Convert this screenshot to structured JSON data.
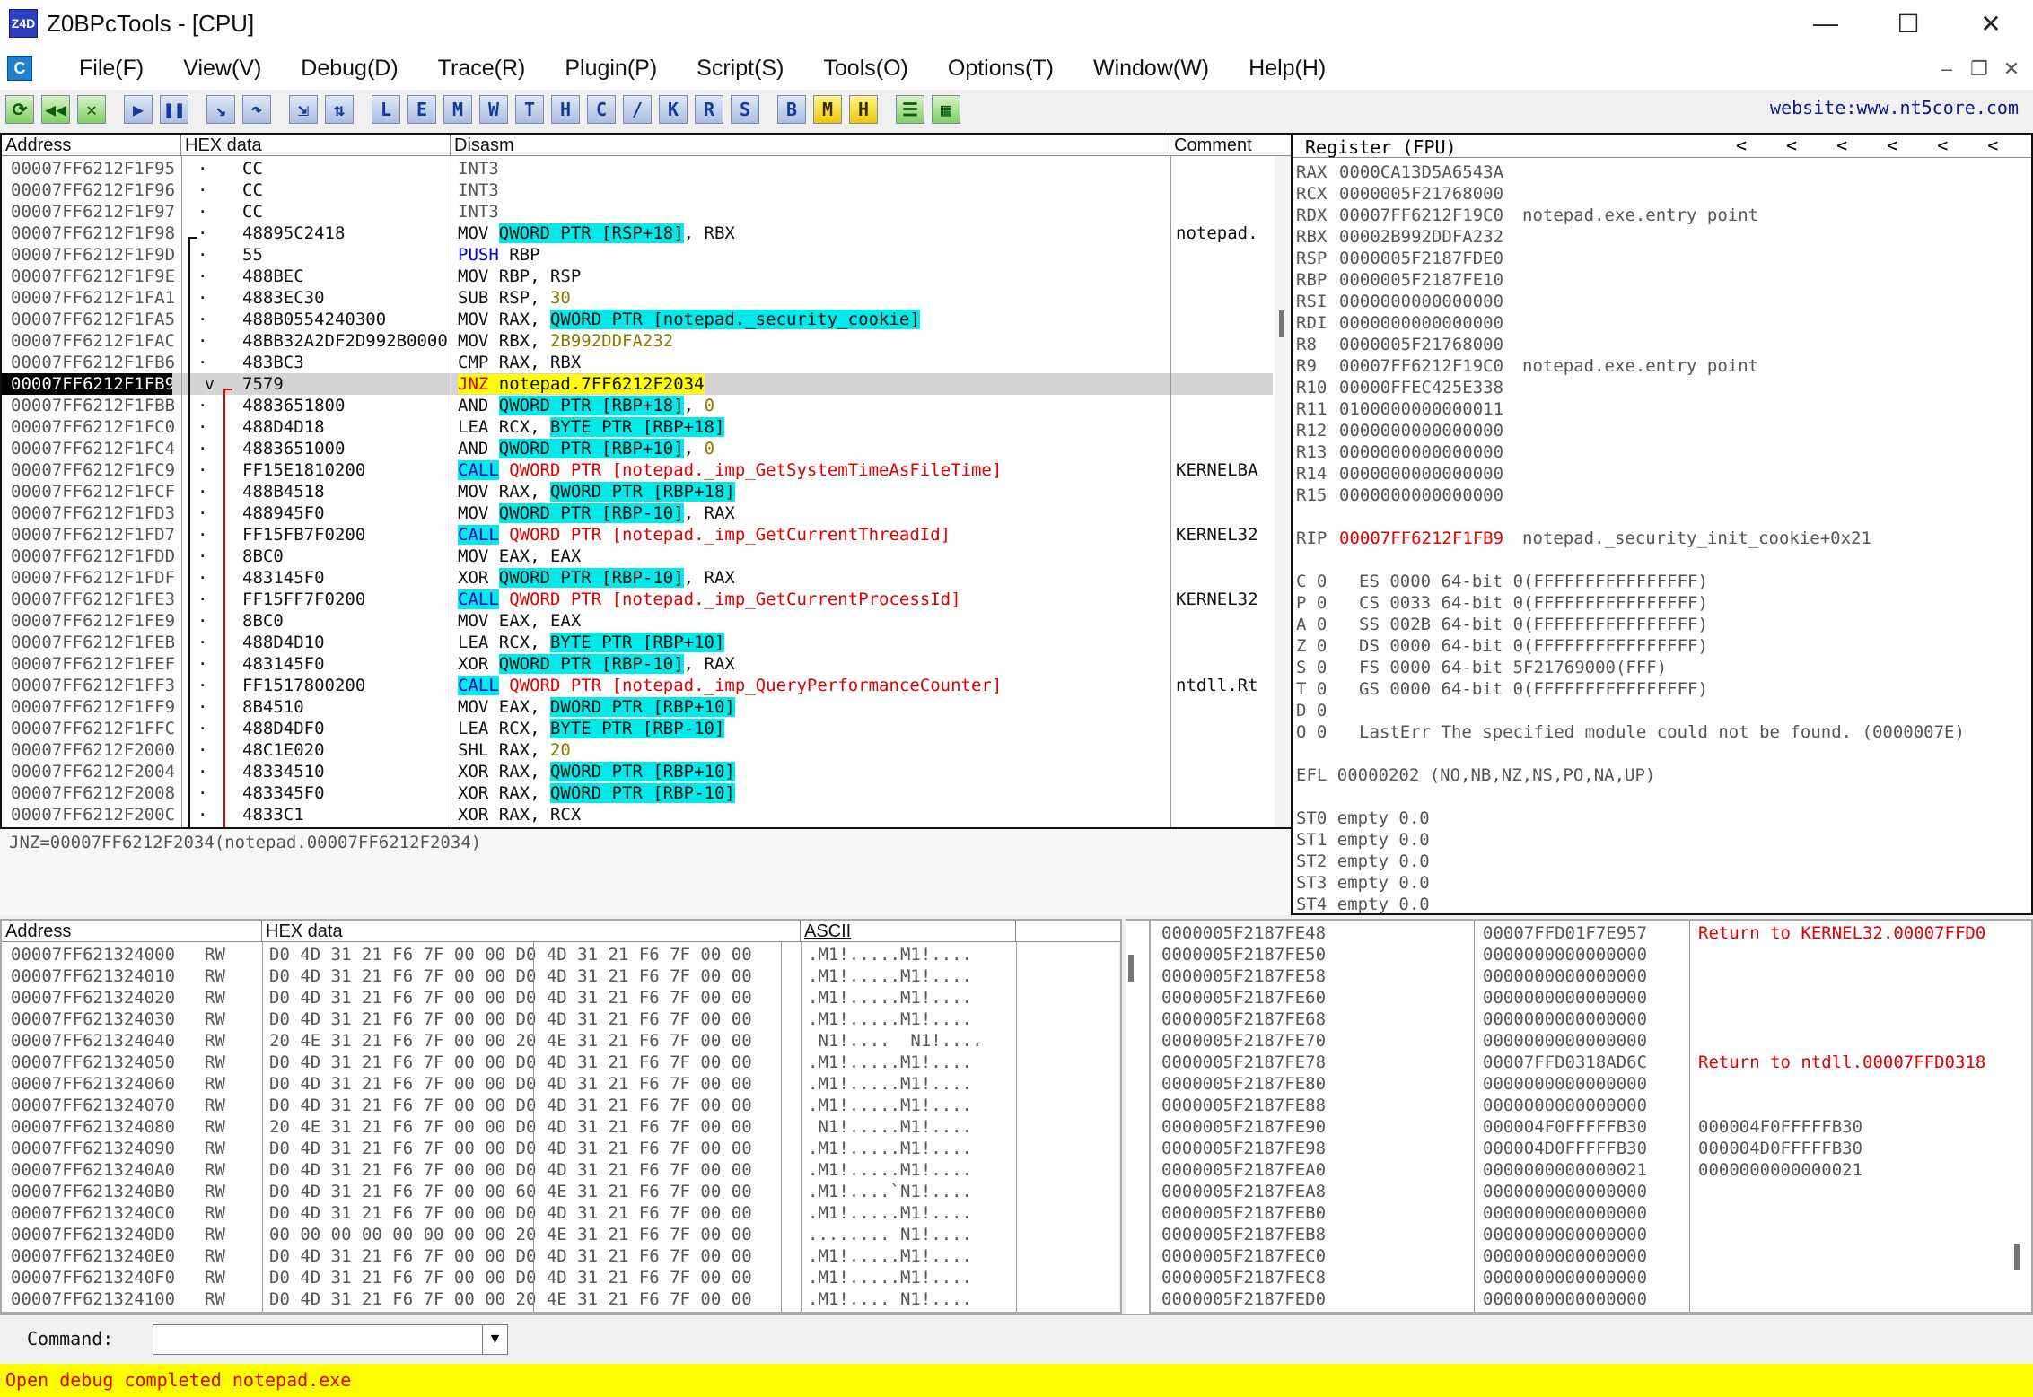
{
  "window": {
    "app_icon_text": "Z4D",
    "title": "Z0BPcTools - [CPU]",
    "minimize": "—",
    "maximize": "☐",
    "close": "✕"
  },
  "menu": {
    "app_icon_text": "C",
    "items": [
      "File(F)",
      "View(V)",
      "Debug(D)",
      "Trace(R)",
      "Plugin(P)",
      "Script(S)",
      "Tools(O)",
      "Options(T)",
      "Window(W)",
      "Help(H)"
    ],
    "mdi_min": "–",
    "mdi_restore": "❐",
    "mdi_close": "✕"
  },
  "toolbar": {
    "buttons": [
      {
        "name": "restart",
        "glyph": "⟳",
        "style": "g"
      },
      {
        "name": "rewind",
        "glyph": "◀◀",
        "style": "g"
      },
      {
        "name": "close-debug",
        "glyph": "✕",
        "style": "g"
      },
      {
        "name": "run",
        "glyph": "▶",
        "style": "",
        "gap": true
      },
      {
        "name": "pause",
        "glyph": "❚❚",
        "style": ""
      },
      {
        "name": "step-into",
        "glyph": "↘",
        "style": "",
        "gap": true
      },
      {
        "name": "step-over",
        "glyph": "↷",
        "style": ""
      },
      {
        "name": "trace-into",
        "glyph": "⇲",
        "style": "",
        "gap": true
      },
      {
        "name": "trace-over",
        "glyph": "⇅",
        "style": ""
      },
      {
        "name": "L",
        "glyph": "L",
        "style": "",
        "gap": true
      },
      {
        "name": "E",
        "glyph": "E",
        "style": ""
      },
      {
        "name": "M",
        "glyph": "M",
        "style": ""
      },
      {
        "name": "W",
        "glyph": "W",
        "style": ""
      },
      {
        "name": "T",
        "glyph": "T",
        "style": ""
      },
      {
        "name": "H",
        "glyph": "H",
        "style": ""
      },
      {
        "name": "C",
        "glyph": "C",
        "style": ""
      },
      {
        "name": "slash",
        "glyph": "/",
        "style": ""
      },
      {
        "name": "K",
        "glyph": "K",
        "style": ""
      },
      {
        "name": "R",
        "glyph": "R",
        "style": ""
      },
      {
        "name": "S",
        "glyph": "S",
        "style": ""
      },
      {
        "name": "B",
        "glyph": "B",
        "style": "",
        "gap": true
      },
      {
        "name": "M-yellow",
        "glyph": "M",
        "style": "y"
      },
      {
        "name": "H-yellow",
        "glyph": "H",
        "style": "y"
      },
      {
        "name": "list",
        "glyph": "☰",
        "style": "g",
        "gap": true
      },
      {
        "name": "grid",
        "glyph": "▦",
        "style": "g"
      }
    ],
    "website": "website:www.nt5core.com"
  },
  "disasm": {
    "headers": {
      "address": "Address",
      "hex": "HEX data",
      "disasm": "Disasm",
      "comment": "Comment"
    },
    "rows": [
      {
        "addr": "00007FF6212F1F95",
        "hex": "CC",
        "ins": [
          {
            "t": "INT3",
            "c": "gray"
          }
        ],
        "comment": ""
      },
      {
        "addr": "00007FF6212F1F96",
        "hex": "CC",
        "ins": [
          {
            "t": "INT3",
            "c": "gray"
          }
        ],
        "comment": ""
      },
      {
        "addr": "00007FF6212F1F97",
        "hex": "CC",
        "ins": [
          {
            "t": "INT3",
            "c": "gray"
          }
        ],
        "comment": ""
      },
      {
        "addr": "00007FF6212F1F98",
        "hex": "48895C2418",
        "ins": [
          {
            "t": "MOV "
          },
          {
            "t": "QWORD PTR [RSP+18]",
            "c": "cyan"
          },
          {
            "t": ", RBX"
          }
        ],
        "comment": "notepad."
      },
      {
        "addr": "00007FF6212F1F9D",
        "hex": "55",
        "ins": [
          {
            "t": "PUSH ",
            "c": "navy"
          },
          {
            "t": "RBP"
          }
        ],
        "comment": ""
      },
      {
        "addr": "00007FF6212F1F9E",
        "hex": "488BEC",
        "ins": [
          {
            "t": "MOV RBP, RSP"
          }
        ],
        "comment": ""
      },
      {
        "addr": "00007FF6212F1FA1",
        "hex": "4883EC30",
        "ins": [
          {
            "t": "SUB RSP, "
          },
          {
            "t": "30",
            "c": "olive"
          }
        ],
        "comment": ""
      },
      {
        "addr": "00007FF6212F1FA5",
        "hex": "488B0554240300",
        "ins": [
          {
            "t": "MOV RAX, "
          },
          {
            "t": "QWORD PTR [notepad._security_cookie]",
            "c": "cyan"
          }
        ],
        "comment": ""
      },
      {
        "addr": "00007FF6212F1FAC",
        "hex": "48BB32A2DF2D992B0000",
        "ins": [
          {
            "t": "MOV RBX, "
          },
          {
            "t": "2B992DDFA232",
            "c": "olive"
          }
        ],
        "comment": ""
      },
      {
        "addr": "00007FF6212F1FB6",
        "hex": "483BC3",
        "ins": [
          {
            "t": "CMP RAX, RBX"
          }
        ],
        "comment": ""
      },
      {
        "addr": "00007FF6212F1FB9",
        "hex": "7579",
        "ins": [
          {
            "t": "JNZ",
            "c": "yelred"
          },
          {
            "t": " notepad.7FF6212F2034",
            "c": "yel"
          }
        ],
        "comment": "",
        "sel": true
      },
      {
        "addr": "00007FF6212F1FBB",
        "hex": "4883651800",
        "ins": [
          {
            "t": "AND "
          },
          {
            "t": "QWORD PTR [RBP+18]",
            "c": "cyan"
          },
          {
            "t": ", "
          },
          {
            "t": "0",
            "c": "olive"
          }
        ],
        "comment": ""
      },
      {
        "addr": "00007FF6212F1FC0",
        "hex": "488D4D18",
        "ins": [
          {
            "t": "LEA RCX, "
          },
          {
            "t": "BYTE PTR [RBP+18]",
            "c": "cyan"
          }
        ],
        "comment": ""
      },
      {
        "addr": "00007FF6212F1FC4",
        "hex": "4883651000",
        "ins": [
          {
            "t": "AND "
          },
          {
            "t": "QWORD PTR [RBP+10]",
            "c": "cyan"
          },
          {
            "t": ", "
          },
          {
            "t": "0",
            "c": "olive"
          }
        ],
        "comment": ""
      },
      {
        "addr": "00007FF6212F1FC9",
        "hex": "FF15E1810200",
        "ins": [
          {
            "t": "CALL",
            "c": "cyanblue"
          },
          {
            "t": " QWORD PTR [notepad._imp_GetSystemTimeAsFileTime]",
            "c": "red"
          }
        ],
        "comment": "KERNELBA"
      },
      {
        "addr": "00007FF6212F1FCF",
        "hex": "488B4518",
        "ins": [
          {
            "t": "MOV RAX, "
          },
          {
            "t": "QWORD PTR [RBP+18]",
            "c": "cyan"
          }
        ],
        "comment": ""
      },
      {
        "addr": "00007FF6212F1FD3",
        "hex": "488945F0",
        "ins": [
          {
            "t": "MOV "
          },
          {
            "t": "QWORD PTR [RBP-10]",
            "c": "cyan"
          },
          {
            "t": ", RAX"
          }
        ],
        "comment": ""
      },
      {
        "addr": "00007FF6212F1FD7",
        "hex": "FF15FB7F0200",
        "ins": [
          {
            "t": "CALL",
            "c": "cyanblue"
          },
          {
            "t": " QWORD PTR [notepad._imp_GetCurrentThreadId]",
            "c": "red"
          }
        ],
        "comment": "KERNEL32"
      },
      {
        "addr": "00007FF6212F1FDD",
        "hex": "8BC0",
        "ins": [
          {
            "t": "MOV EAX, EAX"
          }
        ],
        "comment": ""
      },
      {
        "addr": "00007FF6212F1FDF",
        "hex": "483145F0",
        "ins": [
          {
            "t": "XOR "
          },
          {
            "t": "QWORD PTR [RBP-10]",
            "c": "cyan"
          },
          {
            "t": ", RAX"
          }
        ],
        "comment": ""
      },
      {
        "addr": "00007FF6212F1FE3",
        "hex": "FF15FF7F0200",
        "ins": [
          {
            "t": "CALL",
            "c": "cyanblue"
          },
          {
            "t": " QWORD PTR [notepad._imp_GetCurrentProcessId]",
            "c": "red"
          }
        ],
        "comment": "KERNEL32"
      },
      {
        "addr": "00007FF6212F1FE9",
        "hex": "8BC0",
        "ins": [
          {
            "t": "MOV EAX, EAX"
          }
        ],
        "comment": ""
      },
      {
        "addr": "00007FF6212F1FEB",
        "hex": "488D4D10",
        "ins": [
          {
            "t": "LEA RCX, "
          },
          {
            "t": "BYTE PTR [RBP+10]",
            "c": "cyan"
          }
        ],
        "comment": ""
      },
      {
        "addr": "00007FF6212F1FEF",
        "hex": "483145F0",
        "ins": [
          {
            "t": "XOR "
          },
          {
            "t": "QWORD PTR [RBP-10]",
            "c": "cyan"
          },
          {
            "t": ", RAX"
          }
        ],
        "comment": ""
      },
      {
        "addr": "00007FF6212F1FF3",
        "hex": "FF1517800200",
        "ins": [
          {
            "t": "CALL",
            "c": "cyanblue"
          },
          {
            "t": " QWORD PTR [notepad._imp_QueryPerformanceCounter]",
            "c": "red"
          }
        ],
        "comment": "ntdll.Rt"
      },
      {
        "addr": "00007FF6212F1FF9",
        "hex": "8B4510",
        "ins": [
          {
            "t": "MOV EAX, "
          },
          {
            "t": "DWORD PTR [RBP+10]",
            "c": "cyan"
          }
        ],
        "comment": ""
      },
      {
        "addr": "00007FF6212F1FFC",
        "hex": "488D4DF0",
        "ins": [
          {
            "t": "LEA RCX, "
          },
          {
            "t": "BYTE PTR [RBP-10]",
            "c": "cyan"
          }
        ],
        "comment": ""
      },
      {
        "addr": "00007FF6212F2000",
        "hex": "48C1E020",
        "ins": [
          {
            "t": "SHL RAX, "
          },
          {
            "t": "20",
            "c": "olive"
          }
        ],
        "comment": ""
      },
      {
        "addr": "00007FF6212F2004",
        "hex": "48334510",
        "ins": [
          {
            "t": "XOR RAX, "
          },
          {
            "t": "QWORD PTR [RBP+10]",
            "c": "cyan"
          }
        ],
        "comment": ""
      },
      {
        "addr": "00007FF6212F2008",
        "hex": "483345F0",
        "ins": [
          {
            "t": "XOR RAX, "
          },
          {
            "t": "QWORD PTR [RBP-10]",
            "c": "cyan"
          }
        ],
        "comment": ""
      },
      {
        "addr": "00007FF6212F200C",
        "hex": "4833C1",
        "ins": [
          {
            "t": "XOR RAX, RCX"
          }
        ],
        "comment": ""
      }
    ],
    "jump_marker": "v",
    "info_line": "JNZ=00007FF6212F2034(notepad.00007FF6212F2034)"
  },
  "registers": {
    "header": "Register (FPU)",
    "nav": [
      "<",
      "<",
      "<",
      "<",
      "<",
      "<"
    ],
    "gp": [
      {
        "n": "RAX",
        "v": "0000CA13D5A6543A",
        "c": ""
      },
      {
        "n": "RCX",
        "v": "0000005F21768000",
        "c": ""
      },
      {
        "n": "RDX",
        "v": "00007FF6212F19C0",
        "c": "notepad.exe.entry point"
      },
      {
        "n": "RBX",
        "v": "00002B992DDFA232",
        "c": ""
      },
      {
        "n": "RSP",
        "v": "0000005F2187FDE0",
        "c": ""
      },
      {
        "n": "RBP",
        "v": "0000005F2187FE10",
        "c": ""
      },
      {
        "n": "RSI",
        "v": "0000000000000000",
        "c": ""
      },
      {
        "n": "RDI",
        "v": "0000000000000000",
        "c": ""
      },
      {
        "n": "R8",
        "v": "0000005F21768000",
        "c": ""
      },
      {
        "n": "R9",
        "v": "00007FF6212F19C0",
        "c": "notepad.exe.entry point"
      },
      {
        "n": "R10",
        "v": "00000FFEC425E338",
        "c": ""
      },
      {
        "n": "R11",
        "v": "0100000000000011",
        "c": ""
      },
      {
        "n": "R12",
        "v": "0000000000000000",
        "c": ""
      },
      {
        "n": "R13",
        "v": "0000000000000000",
        "c": ""
      },
      {
        "n": "R14",
        "v": "0000000000000000",
        "c": ""
      },
      {
        "n": "R15",
        "v": "0000000000000000",
        "c": ""
      }
    ],
    "rip": {
      "n": "RIP",
      "v": "00007FF6212F1FB9",
      "c": "notepad._security_init_cookie+0x21"
    },
    "flags": [
      {
        "f": "C 0",
        "s": "ES 0000 64-bit 0(FFFFFFFFFFFFFFFF)"
      },
      {
        "f": "P 0",
        "s": "CS 0033 64-bit 0(FFFFFFFFFFFFFFFF)"
      },
      {
        "f": "A 0",
        "s": "SS 002B 64-bit 0(FFFFFFFFFFFFFFFF)"
      },
      {
        "f": "Z 0",
        "s": "DS 0000 64-bit 0(FFFFFFFFFFFFFFFF)"
      },
      {
        "f": "S 0",
        "s": "FS 0000 64-bit 5F21769000(FFF)"
      },
      {
        "f": "T 0",
        "s": "GS 0000 64-bit 0(FFFFFFFFFFFFFFFF)"
      },
      {
        "f": "D 0",
        "s": ""
      },
      {
        "f": "O 0",
        "s": "LastErr The specified module could not be found. (0000007E)"
      }
    ],
    "efl": "EFL 00000202 (NO,NB,NZ,NS,PO,NA,UP)",
    "fpu": [
      "ST0 empty 0.0",
      "ST1 empty 0.0",
      "ST2 empty 0.0",
      "ST3 empty 0.0",
      "ST4 empty 0.0"
    ]
  },
  "dump": {
    "headers": {
      "address": "Address",
      "hex": "HEX data",
      "ascii": "ASCII"
    },
    "rows": [
      {
        "a": "00007FF621324000",
        "p": "RW",
        "h": "D0 4D 31 21 F6 7F 00 00 D0 4D 31 21 F6 7F 00 00",
        "s": ".M1!.....M1!...."
      },
      {
        "a": "00007FF621324010",
        "p": "RW",
        "h": "D0 4D 31 21 F6 7F 00 00 D0 4D 31 21 F6 7F 00 00",
        "s": ".M1!.....M1!...."
      },
      {
        "a": "00007FF621324020",
        "p": "RW",
        "h": "D0 4D 31 21 F6 7F 00 00 D0 4D 31 21 F6 7F 00 00",
        "s": ".M1!.....M1!...."
      },
      {
        "a": "00007FF621324030",
        "p": "RW",
        "h": "D0 4D 31 21 F6 7F 00 00 D0 4D 31 21 F6 7F 00 00",
        "s": ".M1!.....M1!...."
      },
      {
        "a": "00007FF621324040",
        "p": "RW",
        "h": "20 4E 31 21 F6 7F 00 00 20 4E 31 21 F6 7F 00 00",
        "s": " N1!....  N1!...."
      },
      {
        "a": "00007FF621324050",
        "p": "RW",
        "h": "D0 4D 31 21 F6 7F 00 00 D0 4D 31 21 F6 7F 00 00",
        "s": ".M1!.....M1!...."
      },
      {
        "a": "00007FF621324060",
        "p": "RW",
        "h": "D0 4D 31 21 F6 7F 00 00 D0 4D 31 21 F6 7F 00 00",
        "s": ".M1!.....M1!...."
      },
      {
        "a": "00007FF621324070",
        "p": "RW",
        "h": "D0 4D 31 21 F6 7F 00 00 D0 4D 31 21 F6 7F 00 00",
        "s": ".M1!.....M1!...."
      },
      {
        "a": "00007FF621324080",
        "p": "RW",
        "h": "20 4E 31 21 F6 7F 00 00 D0 4D 31 21 F6 7F 00 00",
        "s": " N1!.....M1!...."
      },
      {
        "a": "00007FF621324090",
        "p": "RW",
        "h": "D0 4D 31 21 F6 7F 00 00 D0 4D 31 21 F6 7F 00 00",
        "s": ".M1!.....M1!...."
      },
      {
        "a": "00007FF6213240A0",
        "p": "RW",
        "h": "D0 4D 31 21 F6 7F 00 00 D0 4D 31 21 F6 7F 00 00",
        "s": ".M1!.....M1!...."
      },
      {
        "a": "00007FF6213240B0",
        "p": "RW",
        "h": "D0 4D 31 21 F6 7F 00 00 60 4E 31 21 F6 7F 00 00",
        "s": ".M1!....`N1!...."
      },
      {
        "a": "00007FF6213240C0",
        "p": "RW",
        "h": "D0 4D 31 21 F6 7F 00 00 D0 4D 31 21 F6 7F 00 00",
        "s": ".M1!.....M1!...."
      },
      {
        "a": "00007FF6213240D0",
        "p": "RW",
        "h": "00 00 00 00 00 00 00 00 20 4E 31 21 F6 7F 00 00",
        "s": "........ N1!...."
      },
      {
        "a": "00007FF6213240E0",
        "p": "RW",
        "h": "D0 4D 31 21 F6 7F 00 00 D0 4D 31 21 F6 7F 00 00",
        "s": ".M1!.....M1!...."
      },
      {
        "a": "00007FF6213240F0",
        "p": "RW",
        "h": "D0 4D 31 21 F6 7F 00 00 D0 4D 31 21 F6 7F 00 00",
        "s": ".M1!.....M1!...."
      },
      {
        "a": "00007FF621324100",
        "p": "RW",
        "h": "D0 4D 31 21 F6 7F 00 00 20 4E 31 21 F6 7F 00 00",
        "s": ".M1!.... N1!...."
      }
    ]
  },
  "stack": {
    "rows": [
      {
        "a": "0000005F2187FE48",
        "v": "00007FFD01F7E957",
        "c": "Return to KERNEL32.00007FFD0"
      },
      {
        "a": "0000005F2187FE50",
        "v": "0000000000000000",
        "c": ""
      },
      {
        "a": "0000005F2187FE58",
        "v": "0000000000000000",
        "c": ""
      },
      {
        "a": "0000005F2187FE60",
        "v": "0000000000000000",
        "c": ""
      },
      {
        "a": "0000005F2187FE68",
        "v": "0000000000000000",
        "c": ""
      },
      {
        "a": "0000005F2187FE70",
        "v": "0000000000000000",
        "c": ""
      },
      {
        "a": "0000005F2187FE78",
        "v": "00007FFD0318AD6C",
        "c": "Return to ntdll.00007FFD0318"
      },
      {
        "a": "0000005F2187FE80",
        "v": "0000000000000000",
        "c": ""
      },
      {
        "a": "0000005F2187FE88",
        "v": "0000000000000000",
        "c": ""
      },
      {
        "a": "0000005F2187FE90",
        "v": "000004F0FFFFFB30",
        "c": "000004F0FFFFFB30",
        "plain": true
      },
      {
        "a": "0000005F2187FE98",
        "v": "000004D0FFFFFB30",
        "c": "000004D0FFFFFB30",
        "plain": true
      },
      {
        "a": "0000005F2187FEA0",
        "v": "0000000000000021",
        "c": "0000000000000021",
        "plain": true
      },
      {
        "a": "0000005F2187FEA8",
        "v": "0000000000000000",
        "c": ""
      },
      {
        "a": "0000005F2187FEB0",
        "v": "0000000000000000",
        "c": ""
      },
      {
        "a": "0000005F2187FEB8",
        "v": "0000000000000000",
        "c": ""
      },
      {
        "a": "0000005F2187FEC0",
        "v": "0000000000000000",
        "c": ""
      },
      {
        "a": "0000005F2187FEC8",
        "v": "0000000000000000",
        "c": ""
      },
      {
        "a": "0000005F2187FED0",
        "v": "0000000000000000",
        "c": ""
      }
    ]
  },
  "command": {
    "label": "Command:",
    "value": ""
  },
  "status": "Open debug completed notepad.exe"
}
